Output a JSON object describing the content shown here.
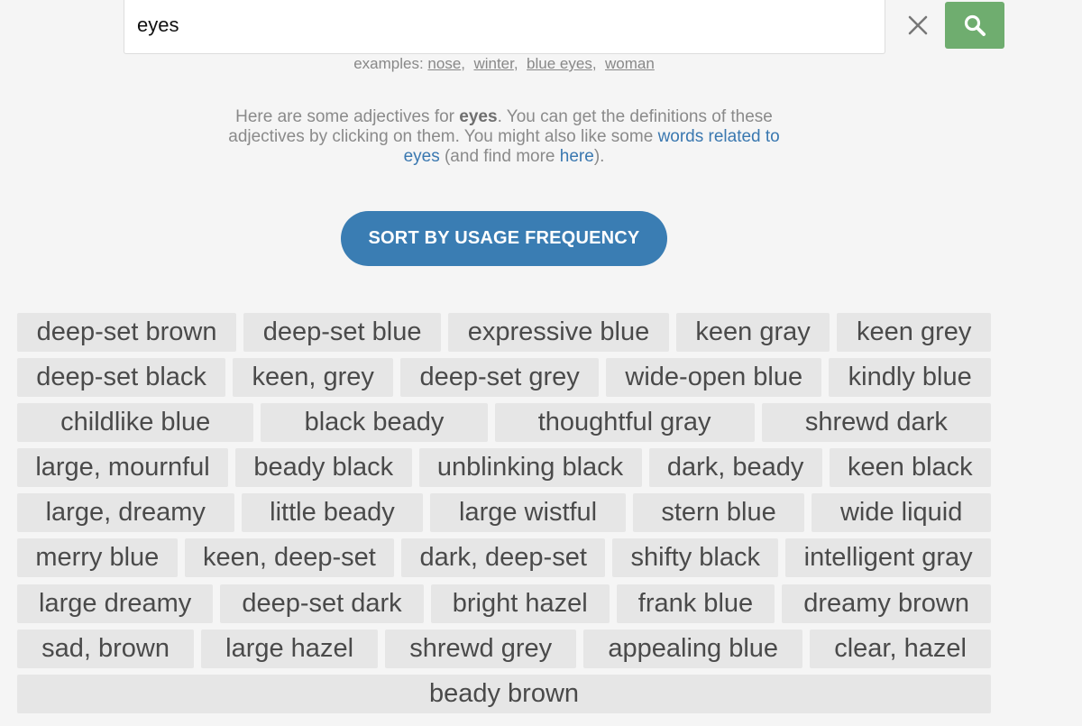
{
  "search": {
    "value": "eyes",
    "placeholder": ""
  },
  "examples": {
    "prefix": "examples:",
    "items": [
      "nose",
      "winter",
      "blue eyes",
      "woman"
    ]
  },
  "intro": {
    "part1": "Here are some adjectives for ",
    "keyword": "eyes",
    "part2": ". You can get the definitions of these adjectives by clicking on them. You might also like some ",
    "link1": "words related to eyes",
    "part3": " (and find more ",
    "link2": "here",
    "part4": ")."
  },
  "sort_button_label": "SORT BY USAGE FREQUENCY",
  "colors": {
    "search_button": "#6fad6f",
    "sort_button": "#3a7db3",
    "link": "#3a78b0",
    "word_chip": "#e6e6e6"
  },
  "icons": {
    "clear": "close-icon",
    "search": "search-icon"
  },
  "rows": [
    [
      "deep-set brown",
      "deep-set blue",
      "expressive blue",
      "keen gray",
      "keen grey"
    ],
    [
      "deep-set black",
      "keen, grey",
      "deep-set grey",
      "wide-open blue",
      "kindly blue"
    ],
    [
      "childlike blue",
      "black beady",
      "thoughtful gray",
      "shrewd dark"
    ],
    [
      "large, mournful",
      "beady black",
      "unblinking black",
      "dark, beady",
      "keen black"
    ],
    [
      "large, dreamy",
      "little beady",
      "large wistful",
      "stern blue",
      "wide liquid"
    ],
    [
      "merry blue",
      "keen, deep-set",
      "dark, deep-set",
      "shifty black",
      "intelligent gray"
    ],
    [
      "large dreamy",
      "deep-set dark",
      "bright hazel",
      "frank blue",
      "dreamy brown"
    ],
    [
      "sad, brown",
      "large hazel",
      "shrewd grey",
      "appealing blue",
      "clear, hazel"
    ],
    [
      "beady brown"
    ]
  ]
}
